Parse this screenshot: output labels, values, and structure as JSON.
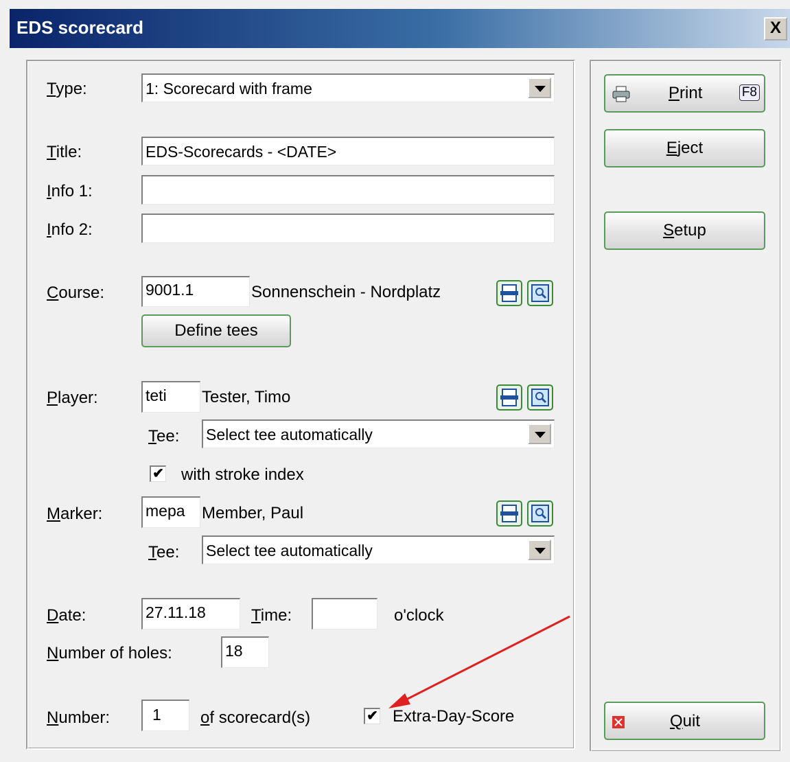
{
  "window": {
    "title": "EDS scorecard",
    "close_glyph": "X"
  },
  "form": {
    "type_label_first": "T",
    "type_label_rest": "ype:",
    "type_value": "1: Scorecard with frame",
    "title_label_first": "T",
    "title_label_rest": "itle:",
    "title_value": "EDS-Scorecards - <DATE>",
    "info1_label_first": "I",
    "info1_label_rest": "nfo 1:",
    "info1_value": "",
    "info2_label_first": "I",
    "info2_label_rest": "nfo 2:",
    "info2_value": "",
    "course_label_first": "C",
    "course_label_rest": "ourse:",
    "course_code": "9001.1",
    "course_name": "Sonnenschein - Nordplatz",
    "define_tees_label": "Define tees",
    "player_label_first": "P",
    "player_label_rest": "layer:",
    "player_code": "teti",
    "player_name": "Tester, Timo",
    "player_tee_label_first": "T",
    "player_tee_label_rest": "ee:",
    "player_tee_value": "Select tee automatically",
    "stroke_index_label": "with stroke index",
    "stroke_index_checked": "✔",
    "marker_label_first": "M",
    "marker_label_rest": "arker:",
    "marker_code": "mepa",
    "marker_name": "Member, Paul",
    "marker_tee_label_first": "T",
    "marker_tee_label_rest": "ee:",
    "marker_tee_value": "Select tee automatically",
    "date_label_first": "D",
    "date_label_rest": "ate:",
    "date_value": "27.11.18",
    "time_label_first": "T",
    "time_label_rest": "ime:",
    "time_value": "",
    "oclock_label": "o'clock",
    "holes_label_first": "N",
    "holes_label_rest": "umber of holes:",
    "holes_value": "18",
    "number_label_first": "N",
    "number_label_rest": "umber:",
    "number_value": "1",
    "of_scorecards_first": "o",
    "of_scorecards_rest": "f scorecard(s)",
    "extra_day_label": "Extra-Day-Score",
    "extra_day_checked": "✔"
  },
  "buttons": {
    "print_first": "P",
    "print_rest": "rint",
    "print_key": "F8",
    "eject_first": "E",
    "eject_rest": "ject",
    "setup_first": "S",
    "setup_rest": "etup",
    "quit_first": "Q",
    "quit_rest": "uit"
  },
  "icons": [
    "printer-icon",
    "list-icon",
    "search-icon",
    "quit-icon"
  ],
  "colors": {
    "titlebar_start": "#0a246a",
    "button_border": "#5a9a5a",
    "annotation_arrow": "#e02020"
  }
}
